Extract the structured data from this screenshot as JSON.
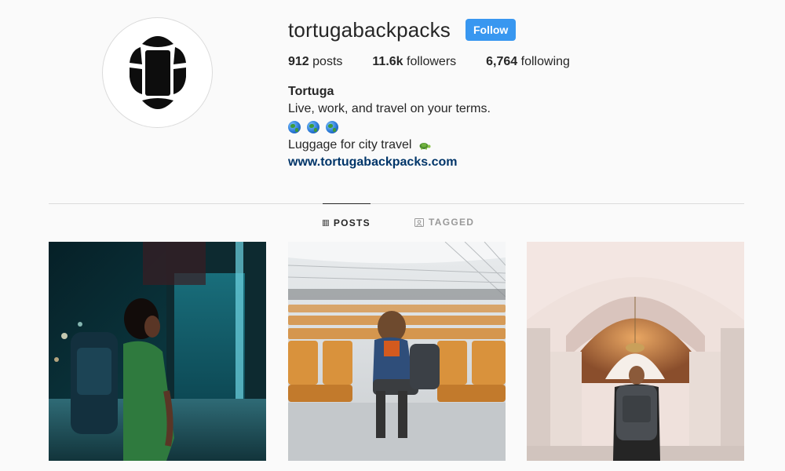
{
  "profile": {
    "username": "tortugabackpacks",
    "follow_label": "Follow",
    "stats": [
      {
        "count": "912",
        "label": "posts"
      },
      {
        "count": "11.6k",
        "label": "followers"
      },
      {
        "count": "6,764",
        "label": "following"
      }
    ],
    "full_name": "Tortuga",
    "bio_line1": "Live, work, and travel on your terms.",
    "bio_emoji": [
      "globe-emoji",
      "globe-emoji",
      "globe-emoji"
    ],
    "bio_line2": "Luggage for city travel",
    "bio_line2_emoji": "turtle-emoji",
    "website": "www.tortugabackpacks.com"
  },
  "tabs": [
    {
      "label": "POSTS",
      "icon": "grid-icon",
      "active": true
    },
    {
      "label": "TAGGED",
      "icon": "tag-icon",
      "active": false
    }
  ],
  "posts": [
    {
      "subject": "woman with backpack on city street at night"
    },
    {
      "subject": "woman with backpack sitting in airport lounge"
    },
    {
      "subject": "man with backpack inside ornate domed building"
    }
  ],
  "colors": {
    "accent": "#3897f0",
    "link": "#003569",
    "text": "#262626",
    "muted": "#999999",
    "background": "#fafafa"
  }
}
